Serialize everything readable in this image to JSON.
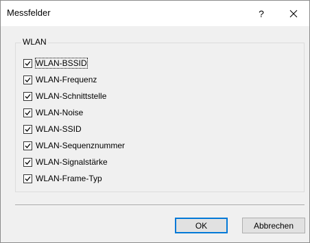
{
  "window": {
    "title": "Messfelder",
    "help_glyph": "?"
  },
  "group": {
    "label": "WLAN",
    "items": [
      {
        "label": "WLAN-BSSID",
        "checked": true
      },
      {
        "label": "WLAN-Frequenz",
        "checked": true
      },
      {
        "label": "WLAN-Schnittstelle",
        "checked": true
      },
      {
        "label": "WLAN-Noise",
        "checked": true
      },
      {
        "label": "WLAN-SSID",
        "checked": true
      },
      {
        "label": "WLAN-Sequenznummer",
        "checked": true
      },
      {
        "label": "WLAN-Signalstärke",
        "checked": true
      },
      {
        "label": "WLAN-Frame-Typ",
        "checked": true
      }
    ]
  },
  "buttons": {
    "ok_label": "OK",
    "cancel_label": "Abbrechen"
  },
  "colors": {
    "accent": "#0078d7",
    "dialog_background": "#f0f0f0"
  },
  "icons": {
    "help": "question-mark-icon",
    "close": "close-icon",
    "check": "checkmark-icon"
  }
}
